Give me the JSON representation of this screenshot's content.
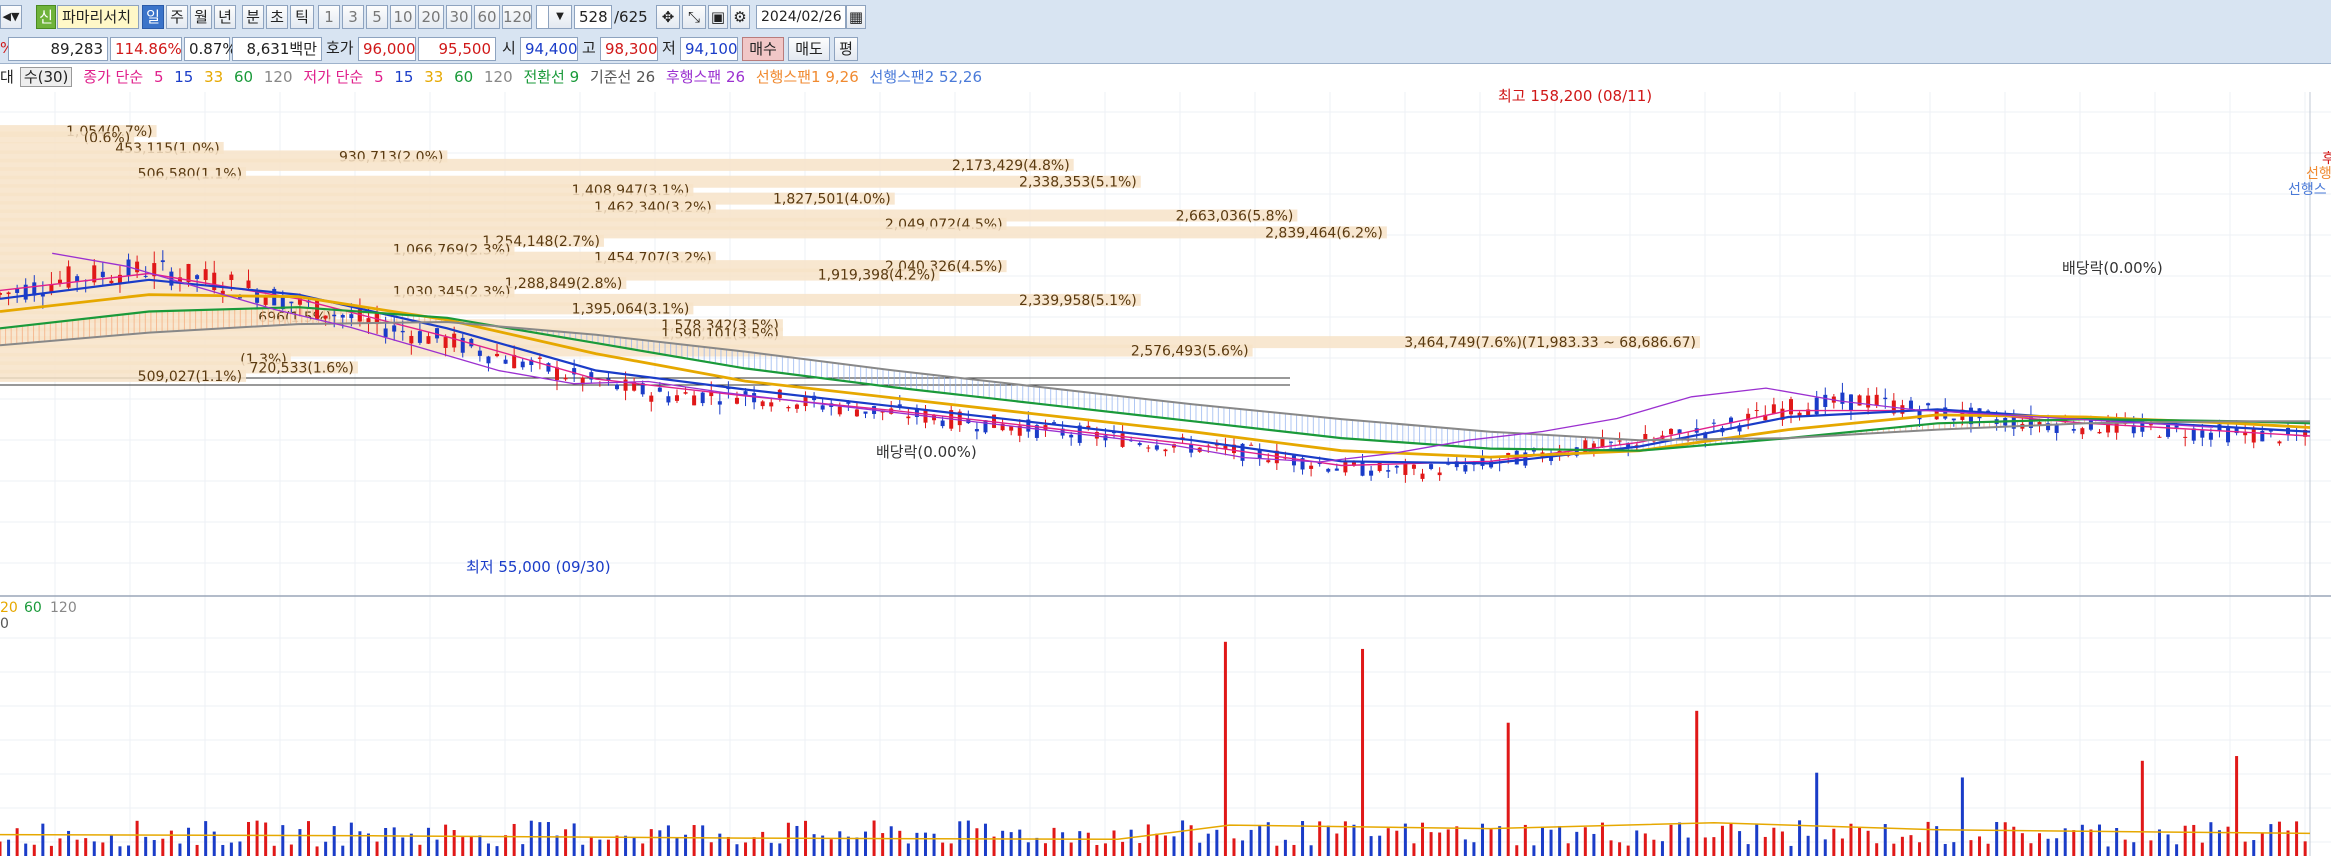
{
  "toolbar": {
    "arrows": "◀▼",
    "badge": "신",
    "stock_name": "파마리서치",
    "periods": [
      "일",
      "주",
      "월",
      "년",
      "분",
      "초",
      "틱"
    ],
    "active_period": "일",
    "intervals": [
      "1",
      "3",
      "5",
      "10",
      "20",
      "30",
      "60",
      "120"
    ],
    "count": "528",
    "total": "/625",
    "date": "2024/02/26"
  },
  "quote": {
    "pct_prefix": "%",
    "volume": "89,283",
    "vol_ratio": "114.86%",
    "turnover": "0.87%",
    "amount": "8,631백만",
    "bid_label": "호가",
    "bid1": "96,000",
    "bid2": "95,500",
    "open_label": "시",
    "open": "94,400",
    "high_label": "고",
    "high": "98,300",
    "low_label": "저",
    "low": "94,100",
    "buy_label": "매수",
    "sell_label": "매도",
    "eval_label": "평"
  },
  "legend": {
    "prefix": "대",
    "indicator": "수(30)",
    "close_ma": "종가 단순",
    "close_periods": [
      "5",
      "15",
      "33",
      "60",
      "120"
    ],
    "low_ma": "저가 단순",
    "low_periods": [
      "5",
      "15",
      "33",
      "60",
      "120"
    ],
    "conversion": "전환선 9",
    "base": "기준선 26",
    "lagging": "후행스팬 26",
    "lead1": "선행스팬1 9,26",
    "lead2": "선행스팬2 52,26",
    "colors": {
      "ma5": "#e0208c",
      "ma15": "#1a3cc8",
      "ma33": "#e6a800",
      "ma60": "#1a9a3a",
      "ma120": "#888888",
      "conversion": "#1a9a3a",
      "base": "#555555",
      "lagging": "#9b30d0",
      "lead1": "#f08a30",
      "lead2": "#4a7ad8"
    }
  },
  "chart_data": {
    "type": "candlestick",
    "price_axis": {
      "ylim": [
        50000,
        168000
      ]
    },
    "x_range": [
      0,
      620
    ],
    "volume_prefix": "0",
    "annotations": {
      "high_label": "최고 158,200 (08/11)",
      "low_label": "최저 55,000 (09/30)",
      "dividend1": "배당락(0.00%)",
      "dividend2": "배당락(0.00%)",
      "right_labels": [
        "후",
        "선행",
        "선행스"
      ],
      "vol_legend": [
        "20",
        "60",
        "120"
      ]
    },
    "volume_profile": [
      {
        "price": 158500,
        "label": "1,054(0.7%)",
        "pct": 0.7
      },
      {
        "price": 157000,
        "label": "(0.6%)",
        "pct": 0.6
      },
      {
        "price": 154500,
        "label": "453,115(1.0%)",
        "pct": 1.0
      },
      {
        "price": 152500,
        "label": "930,713(2.0%)",
        "pct": 2.0
      },
      {
        "price": 150500,
        "label": "2,173,429(4.8%)",
        "pct": 4.8
      },
      {
        "price": 148500,
        "label": "506,580(1.1%)",
        "pct": 1.1
      },
      {
        "price": 146500,
        "label": "2,338,353(5.1%)",
        "pct": 5.1
      },
      {
        "price": 144500,
        "label": "1,408,947(3.1%)",
        "pct": 3.1
      },
      {
        "price": 142500,
        "label": "1,827,501(4.0%)",
        "pct": 4.0
      },
      {
        "price": 140500,
        "label": "1,462,340(3.2%)",
        "pct": 3.2
      },
      {
        "price": 138500,
        "label": "2,663,036(5.8%)",
        "pct": 5.8
      },
      {
        "price": 136500,
        "label": "2,049,072(4.5%)",
        "pct": 4.5
      },
      {
        "price": 134500,
        "label": "2,839,464(6.2%)",
        "pct": 6.2
      },
      {
        "price": 132500,
        "label": "1,254,148(2.7%)",
        "pct": 2.7
      },
      {
        "price": 130500,
        "label": "1,066,769(2.3%)",
        "pct": 2.3
      },
      {
        "price": 128500,
        "label": "1,454,707(3.2%)",
        "pct": 3.2
      },
      {
        "price": 126500,
        "label": "2,040,326(4.5%)",
        "pct": 4.5
      },
      {
        "price": 124500,
        "label": "1,919,398(4.2%)",
        "pct": 4.2
      },
      {
        "price": 122500,
        "label": "1,288,849(2.8%)",
        "pct": 2.8
      },
      {
        "price": 120500,
        "label": "1,030,345(2.3%)",
        "pct": 2.3
      },
      {
        "price": 118500,
        "label": "2,339,958(5.1%)",
        "pct": 5.1
      },
      {
        "price": 116500,
        "label": "1,395,064(3.1%)",
        "pct": 3.1
      },
      {
        "price": 114500,
        "label": "696(1.5%)",
        "pct": 1.5
      },
      {
        "price": 112500,
        "label": "1,578,342(3.5%)",
        "pct": 3.5
      },
      {
        "price": 110500,
        "label": "1,590,101(3.5%)",
        "pct": 3.5
      },
      {
        "price": 108500,
        "label": "3,464,749(7.6%)(71,983.33 ~ 68,686.67)",
        "pct": 7.6
      },
      {
        "price": 106500,
        "label": "2,576,493(5.6%)",
        "pct": 5.6
      },
      {
        "price": 104500,
        "label": "(1.3%)",
        "pct": 1.3
      },
      {
        "price": 102500,
        "label": "720,533(1.6%)",
        "pct": 1.6
      },
      {
        "price": 100500,
        "label": "509,027(1.1%)",
        "pct": 1.1
      }
    ],
    "close_path": [
      [
        0,
        120000
      ],
      [
        20,
        124000
      ],
      [
        40,
        126000
      ],
      [
        60,
        123000
      ],
      [
        80,
        118000
      ],
      [
        100,
        113000
      ],
      [
        120,
        109000
      ],
      [
        140,
        104000
      ],
      [
        160,
        99000
      ],
      [
        180,
        96000
      ],
      [
        200,
        96500
      ],
      [
        220,
        94000
      ],
      [
        240,
        92000
      ],
      [
        260,
        90000
      ],
      [
        280,
        88000
      ],
      [
        300,
        86000
      ],
      [
        320,
        84000
      ],
      [
        340,
        82000
      ],
      [
        360,
        79000
      ],
      [
        380,
        78000
      ],
      [
        400,
        80000
      ],
      [
        420,
        83000
      ],
      [
        440,
        85000
      ],
      [
        460,
        88000
      ],
      [
        480,
        93000
      ],
      [
        500,
        95000
      ],
      [
        520,
        92000
      ],
      [
        540,
        90000
      ],
      [
        560,
        89000
      ],
      [
        580,
        88000
      ],
      [
        600,
        87000
      ],
      [
        620,
        86000
      ]
    ],
    "ma_paths": {
      "ma5": [
        [
          0,
          121000
        ],
        [
          40,
          125000
        ],
        [
          80,
          119000
        ],
        [
          120,
          110000
        ],
        [
          160,
          100000
        ],
        [
          200,
          96000
        ],
        [
          240,
          92500
        ],
        [
          280,
          88500
        ],
        [
          320,
          84500
        ],
        [
          360,
          79500
        ],
        [
          400,
          80500
        ],
        [
          440,
          85000
        ],
        [
          480,
          92500
        ],
        [
          520,
          92500
        ],
        [
          560,
          89500
        ],
        [
          600,
          87500
        ],
        [
          620,
          86500
        ]
      ],
      "ma15": [
        [
          0,
          119000
        ],
        [
          40,
          123500
        ],
        [
          80,
          120000
        ],
        [
          120,
          112000
        ],
        [
          160,
          102000
        ],
        [
          200,
          97500
        ],
        [
          240,
          93500
        ],
        [
          280,
          89500
        ],
        [
          320,
          85500
        ],
        [
          360,
          80500
        ],
        [
          400,
          80000
        ],
        [
          440,
          84000
        ],
        [
          480,
          91000
        ],
        [
          520,
          92800
        ],
        [
          560,
          90500
        ],
        [
          600,
          88500
        ],
        [
          620,
          87500
        ]
      ],
      "ma33": [
        [
          0,
          116000
        ],
        [
          40,
          120000
        ],
        [
          80,
          119500
        ],
        [
          120,
          114000
        ],
        [
          160,
          106000
        ],
        [
          200,
          99500
        ],
        [
          240,
          95500
        ],
        [
          280,
          91500
        ],
        [
          320,
          87500
        ],
        [
          360,
          83000
        ],
        [
          400,
          81500
        ],
        [
          440,
          83000
        ],
        [
          480,
          88000
        ],
        [
          520,
          91500
        ],
        [
          560,
          91000
        ],
        [
          600,
          89500
        ],
        [
          620,
          88500
        ]
      ],
      "ma60": [
        [
          0,
          112000
        ],
        [
          40,
          116000
        ],
        [
          80,
          117000
        ],
        [
          120,
          114500
        ],
        [
          160,
          108500
        ],
        [
          200,
          102500
        ],
        [
          240,
          98000
        ],
        [
          280,
          94000
        ],
        [
          320,
          90000
        ],
        [
          360,
          86000
        ],
        [
          400,
          83500
        ],
        [
          440,
          83000
        ],
        [
          480,
          86000
        ],
        [
          520,
          89500
        ],
        [
          560,
          90500
        ],
        [
          600,
          90000
        ],
        [
          620,
          89500
        ]
      ],
      "ma120": [
        [
          0,
          108000
        ],
        [
          40,
          111000
        ],
        [
          80,
          113000
        ],
        [
          120,
          113500
        ],
        [
          160,
          110500
        ],
        [
          200,
          106500
        ],
        [
          240,
          102000
        ],
        [
          280,
          98000
        ],
        [
          320,
          94000
        ],
        [
          360,
          90500
        ],
        [
          400,
          87500
        ],
        [
          440,
          85500
        ],
        [
          480,
          86000
        ],
        [
          520,
          88000
        ],
        [
          560,
          89500
        ],
        [
          600,
          90000
        ],
        [
          620,
          90000
        ]
      ]
    },
    "volume": {
      "ylim": [
        0,
        1000
      ],
      "spikes": [
        [
          330,
          900
        ],
        [
          366,
          870
        ],
        [
          405,
          560
        ],
        [
          455,
          610
        ],
        [
          487,
          350
        ],
        [
          526,
          330
        ],
        [
          575,
          400
        ],
        [
          600,
          420
        ]
      ]
    }
  }
}
